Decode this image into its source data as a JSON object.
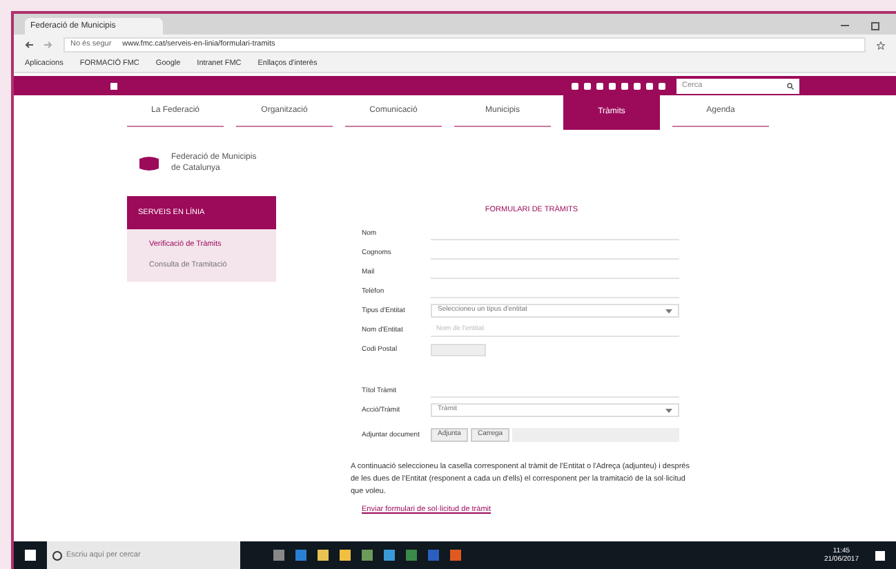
{
  "browser": {
    "tab_title": "Federació de Municipis",
    "url_security": "No és segur",
    "url": "www.fmc.cat/serveis-en-linia/formulari-tramits",
    "bookmarks": [
      "Aplicacions",
      "FORMACIÓ FMC",
      "Google",
      "Intranet FMC",
      "Enllaços d'interès"
    ]
  },
  "top_bar": {
    "search": {
      "placeholder": "Cerca"
    }
  },
  "nav": [
    {
      "label": "La Federació",
      "selected": false
    },
    {
      "label": "Organització",
      "selected": false
    },
    {
      "label": "Comunicació",
      "selected": false
    },
    {
      "label": "Municipis",
      "selected": false
    },
    {
      "label": "Tràmits",
      "selected": true
    },
    {
      "label": "Agenda",
      "selected": false
    }
  ],
  "logo": {
    "line1": "Federació de Municipis",
    "line2": "de Catalunya"
  },
  "sidebar": {
    "header": "SERVEIS EN LÍNIA",
    "items": [
      {
        "label": "Verificació de Tràmits",
        "selected": true
      },
      {
        "label": "Consulta de Tramitació",
        "selected": false
      }
    ]
  },
  "form": {
    "title": "FORMULARI DE TRÀMITS",
    "fields": [
      {
        "kind": "text",
        "label": "Nom"
      },
      {
        "kind": "text",
        "label": "Cognoms"
      },
      {
        "kind": "text",
        "label": "Mail"
      },
      {
        "kind": "text",
        "label": "Telèfon"
      },
      {
        "kind": "select",
        "label": "Tipus d'Entitat",
        "value": "Seleccioneu un tipus d'entitat"
      },
      {
        "kind": "text",
        "label": "Nom d'Entitat",
        "placeholder": "Nom de l'entitat"
      },
      {
        "kind": "short",
        "label": "Codi Postal"
      },
      {
        "kind": "gap"
      },
      {
        "kind": "text",
        "label": "Títol Tràmit"
      },
      {
        "kind": "select",
        "label": "Acció/Tràmit",
        "value": "Tràmit"
      },
      {
        "kind": "file",
        "label": "Adjuntar document",
        "buttons": [
          "Adjunta",
          "Carrega"
        ]
      }
    ],
    "note": "A continuació seleccioneu la casella corresponent al tràmit de l'Entitat o l'Adreça (adjunteu) i després de les dues de l'Entitat (responent a cada un d'ells) el corresponent per la tramitació de la sol·licitud que voleu.",
    "link": "Enviar formulari de sol·licitud de tràmit"
  },
  "taskbar": {
    "search": {
      "placeholder": "Escriu aquí per cercar"
    },
    "time": "11:45",
    "date": "21/06/2017"
  }
}
